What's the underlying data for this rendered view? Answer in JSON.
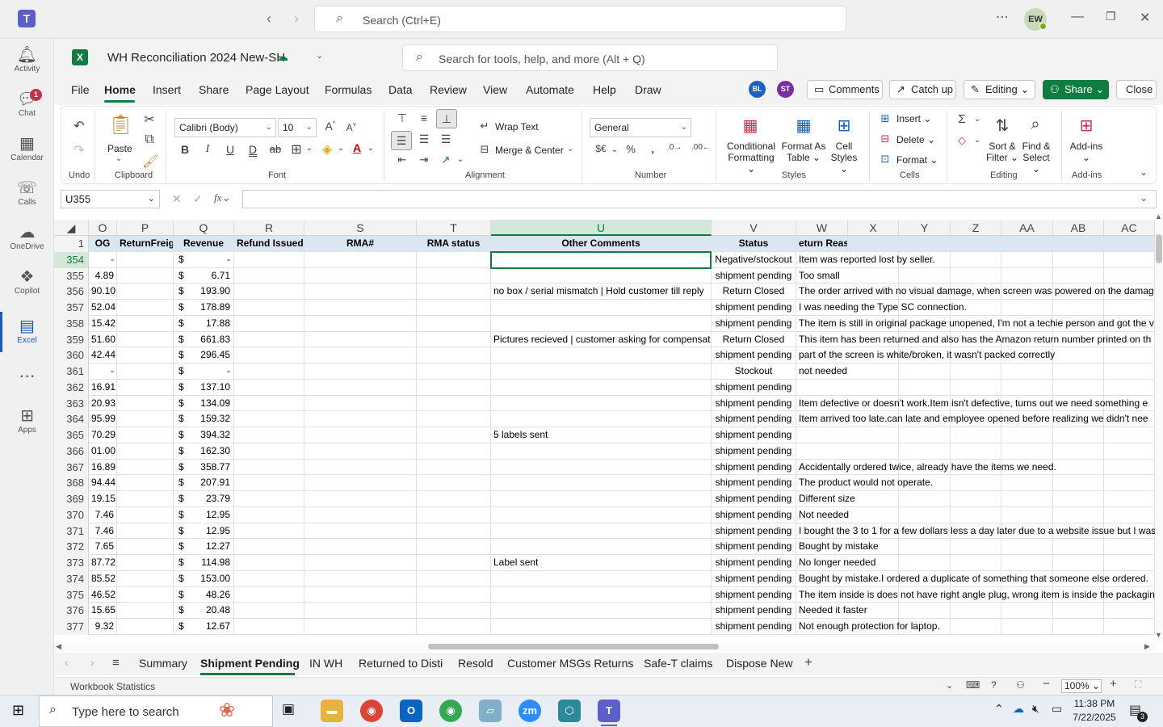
{
  "teams": {
    "search_placeholder": "Search (Ctrl+E)",
    "user_initials": "EW",
    "rail": [
      {
        "label": "Activity",
        "icon": "bell-icon"
      },
      {
        "label": "Chat",
        "icon": "chat-icon",
        "badge": "1"
      },
      {
        "label": "Calendar",
        "icon": "calendar-icon"
      },
      {
        "label": "Calls",
        "icon": "phone-icon"
      },
      {
        "label": "OneDrive",
        "icon": "cloud-icon"
      },
      {
        "label": "Copilot",
        "icon": "copilot-icon"
      },
      {
        "label": "Excel",
        "icon": "excel-icon",
        "active": true
      },
      {
        "label": "",
        "icon": "more-icon"
      },
      {
        "label": "Apps",
        "icon": "apps-icon"
      }
    ]
  },
  "excel": {
    "doc_title": "WH Reconciliation 2024 New-SH",
    "tools_search_placeholder": "Search for tools, help, and more (Alt + Q)",
    "menu_tabs": [
      "File",
      "Home",
      "Insert",
      "Share",
      "Page Layout",
      "Formulas",
      "Data",
      "Review",
      "View",
      "Automate",
      "Help",
      "Draw"
    ],
    "active_tab": "Home",
    "coauthors": [
      "BL",
      "ST"
    ],
    "buttons": {
      "comments": "Comments",
      "catch_up": "Catch up",
      "editing": "Editing",
      "share": "Share",
      "close": "Close"
    },
    "ribbon": {
      "undo_group": "Undo",
      "paste": "Paste",
      "clipboard_group": "Clipboard",
      "font_name": "Calibri (Body)",
      "font_size": "10",
      "font_group": "Font",
      "wrap_text": "Wrap Text",
      "merge_center": "Merge & Center",
      "alignment_group": "Alignment",
      "number_format": "General",
      "number_group": "Number",
      "conditional_formatting_1": "Conditional",
      "conditional_formatting_2": "Formatting",
      "format_table_1": "Format As",
      "format_table_2": "Table",
      "cell_styles_1": "Cell",
      "cell_styles_2": "Styles",
      "styles_group": "Styles",
      "insert": "Insert",
      "delete": "Delete",
      "format": "Format",
      "cells_group": "Cells",
      "sort_filter_1": "Sort &",
      "sort_filter_2": "Filter",
      "find_select_1": "Find &",
      "find_select_2": "Select",
      "editing_group": "Editing",
      "addins": "Add-ins",
      "addins_group": "Add-ins"
    },
    "name_box": "U355",
    "columns": [
      {
        "key": "O",
        "width": 35
      },
      {
        "key": "P",
        "width": 70
      },
      {
        "key": "Q",
        "width": 75
      },
      {
        "key": "R",
        "width": 87
      },
      {
        "key": "S",
        "width": 139
      },
      {
        "key": "T",
        "width": 92
      },
      {
        "key": "U",
        "width": 273
      },
      {
        "key": "V",
        "width": 105
      },
      {
        "key": "W",
        "width": 64
      },
      {
        "key": "X",
        "width": 63
      },
      {
        "key": "Y",
        "width": 64
      },
      {
        "key": "Z",
        "width": 63
      },
      {
        "key": "AA",
        "width": 64
      },
      {
        "key": "AB",
        "width": 63
      },
      {
        "key": "AC",
        "width": 63
      }
    ],
    "selected_column": "U",
    "header_row": {
      "num": "1",
      "O": "OG",
      "P": "ReturnFreight",
      "Q": "Revenue",
      "R": "Refund Issued",
      "S": "RMA#",
      "T": "RMA status",
      "U": "Other Comments",
      "V": "Status",
      "W": "eturn Reason"
    },
    "rows": [
      {
        "num": "354",
        "O": "-",
        "Q": "-",
        "U": "",
        "V": "Negative/stockout",
        "W": "Item was reported lost by seller."
      },
      {
        "num": "355",
        "O": "4.89",
        "Q": "6.71",
        "U": "",
        "V": "shipment pending",
        "W": "Too small"
      },
      {
        "num": "356",
        "O": "90.10",
        "Q": "193.90",
        "U": "no box / serial mismatch  | Hold customer till reply",
        "V": "Return Closed",
        "W": "The order arrived with no visual damage, when screen was powered on the damag"
      },
      {
        "num": "357",
        "O": "52.04",
        "Q": "178.89",
        "U": "",
        "V": "shipment pending",
        "W": "I was needing the Type SC connection."
      },
      {
        "num": "358",
        "O": "15.42",
        "Q": "17.88",
        "U": "",
        "V": "shipment pending",
        "W": "The item is still in original package unopened, I'm not a techie person and got the v"
      },
      {
        "num": "359",
        "O": "51.60",
        "Q": "661.83",
        "U": "Pictures recieved | customer asking for compensat",
        "V": "Return Closed",
        "W": "This item has been returned and also has the Amazon return number printed on th"
      },
      {
        "num": "360",
        "O": "42.44",
        "Q": "296.45",
        "U": "",
        "V": "shipment pending",
        "W": "part of the screen is white/broken, it wasn't packed correctly"
      },
      {
        "num": "361",
        "O": "-",
        "Q": "-",
        "U": "",
        "V": "Stockout",
        "W": "not needed"
      },
      {
        "num": "362",
        "O": "16.91",
        "Q": "137.10",
        "U": "",
        "V": "shipment pending",
        "W": ""
      },
      {
        "num": "363",
        "O": "20.93",
        "Q": "134.09",
        "U": "",
        "V": "shipment pending",
        "W": "Item defective or doesn't work.Item isn't defective, turns out we need something e"
      },
      {
        "num": "364",
        "O": "95.99",
        "Q": "159.32",
        "U": "",
        "V": "shipment pending",
        "W": "Item arrived too late.can late and employee opened before realizing we didn't nee"
      },
      {
        "num": "365",
        "O": "70.29",
        "Q": "394.32",
        "U": "5 labels sent",
        "V": "shipment pending",
        "W": ""
      },
      {
        "num": "366",
        "O": "01.00",
        "Q": "162.30",
        "U": "",
        "V": "shipment pending",
        "W": ""
      },
      {
        "num": "367",
        "O": "16.89",
        "Q": "358.77",
        "U": "",
        "V": "shipment pending",
        "W": "Accidentally ordered twice, already have the items we need."
      },
      {
        "num": "368",
        "O": "94.44",
        "Q": "207.91",
        "U": "",
        "V": "shipment pending",
        "W": "The product would not operate."
      },
      {
        "num": "369",
        "O": "19.15",
        "Q": "23.79",
        "U": "",
        "V": "shipment pending",
        "W": "Different size"
      },
      {
        "num": "370",
        "O": "7.46",
        "Q": "12.95",
        "U": "",
        "V": "shipment pending",
        "W": "Not needed"
      },
      {
        "num": "371",
        "O": "7.46",
        "Q": "12.95",
        "U": "",
        "V": "shipment pending",
        "W": "I bought the 3 to 1 for a few dollars less a day later due to a website issue but I was"
      },
      {
        "num": "372",
        "O": "7.65",
        "Q": "12.27",
        "U": "",
        "V": "shipment pending",
        "W": "Bought by mistake"
      },
      {
        "num": "373",
        "O": "87.72",
        "Q": "114.98",
        "U": "Label sent",
        "V": "shipment pending",
        "W": "No longer needed"
      },
      {
        "num": "374",
        "O": "85.52",
        "Q": "153.00",
        "U": "",
        "V": "shipment pending",
        "W": "Bought by mistake.I ordered a duplicate of something that someone else ordered."
      },
      {
        "num": "375",
        "O": "46.52",
        "Q": "48.26",
        "U": "",
        "V": "shipment pending",
        "W": "The item inside is does not have right angle plug, wrong item is inside the packagin"
      },
      {
        "num": "376",
        "O": "15.65",
        "Q": "20.48",
        "U": "",
        "V": "shipment pending",
        "W": "Needed it faster"
      },
      {
        "num": "377",
        "O": "9.32",
        "Q": "12.67",
        "U": "",
        "V": "shipment pending",
        "W": "Not enough protection for laptop."
      }
    ],
    "currency_symbol": "$",
    "sheet_tabs": [
      "Summary",
      "Shipment Pending",
      "IN WH",
      "Returned to Disti",
      "Resold",
      "Customer MSGs Returns",
      "Safe-T claims",
      "Dispose New"
    ],
    "active_sheet": "Shipment Pending",
    "status_text": "Workbook Statistics",
    "zoom": "100%"
  },
  "taskbar": {
    "search_placeholder": "Type here to search",
    "time": "11:38 PM",
    "date": "7/22/2025",
    "notif_count": "3"
  },
  "colors": {
    "excel_green": "#107c41",
    "teams_purple": "#5b5fc7",
    "header_fill": "#dbe6f3"
  }
}
